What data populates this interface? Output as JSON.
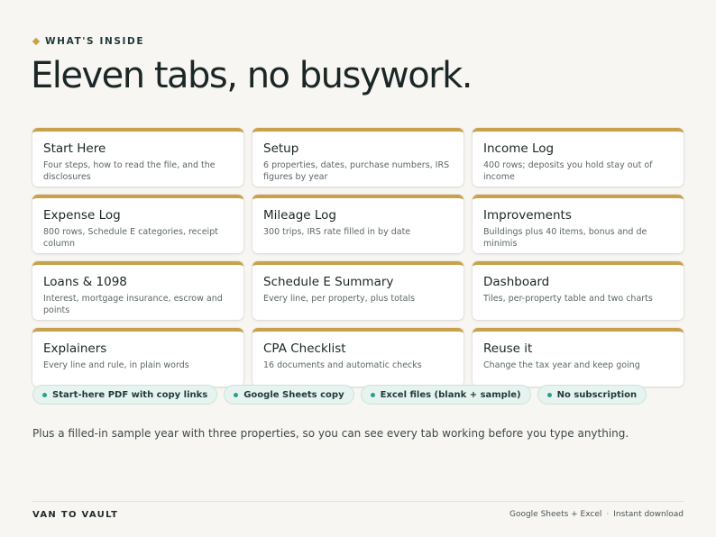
{
  "eyebrow": "WHAT'S INSIDE",
  "headline": "Eleven tabs, no busywork.",
  "cards": [
    {
      "title": "Start Here",
      "desc": "Four steps, how to read the file, and the disclosures"
    },
    {
      "title": "Setup",
      "desc": "6 properties, dates, purchase numbers, IRS figures by year"
    },
    {
      "title": "Income Log",
      "desc": "400 rows; deposits you hold stay out of income"
    },
    {
      "title": "Expense Log",
      "desc": "800 rows, Schedule E categories, receipt column"
    },
    {
      "title": "Mileage Log",
      "desc": "300 trips, IRS rate filled in by date"
    },
    {
      "title": "Improvements",
      "desc": "Buildings plus 40 items, bonus and de minimis"
    },
    {
      "title": "Loans & 1098",
      "desc": "Interest, mortgage insurance, escrow and points"
    },
    {
      "title": "Schedule E Summary",
      "desc": "Every line, per property, plus totals"
    },
    {
      "title": "Dashboard",
      "desc": "Tiles, per-property table and two charts"
    },
    {
      "title": "Explainers",
      "desc": "Every line and rule, in plain words"
    },
    {
      "title": "CPA Checklist",
      "desc": "16 documents and automatic checks"
    },
    {
      "title": "Reuse it",
      "desc": "Change the tax year and keep going"
    }
  ],
  "chips": [
    "Start-here PDF with copy links",
    "Google Sheets copy",
    "Excel files (blank + sample)",
    "No subscription"
  ],
  "note": "Plus a filled-in sample year with three properties, so you can see every tab working before you type anything.",
  "footer": {
    "brand": "VAN TO VAULT",
    "formats": "Google Sheets + Excel",
    "separator": "·",
    "delivery": "Instant download"
  },
  "colors": {
    "accent_gold": "#c9a14a",
    "chip_bg": "#e6f3ef",
    "chip_dot": "#2aa08a",
    "background": "#f8f6f3"
  }
}
